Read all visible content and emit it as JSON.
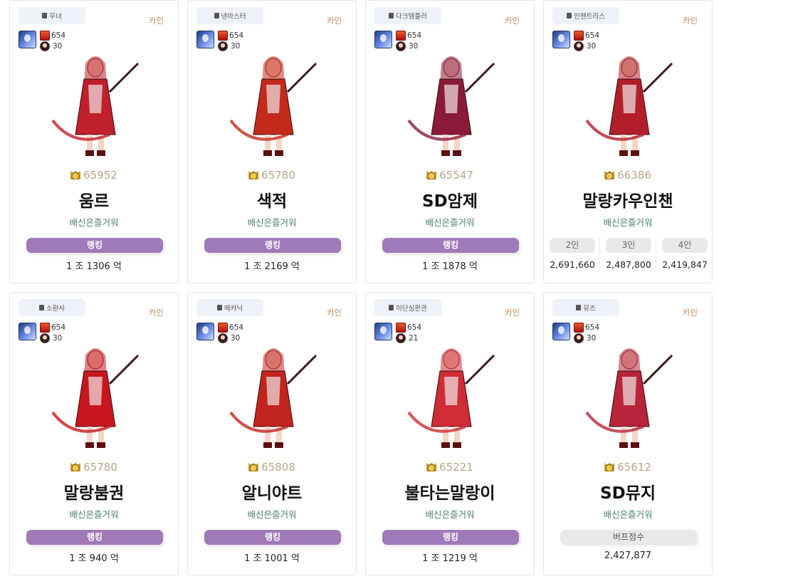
{
  "cards": [
    {
      "job": "무녀",
      "server": "카인",
      "fame": "654",
      "level": "30",
      "power": "65952",
      "name": "움르",
      "guild": "배신은즐거워",
      "rank_label": "랭킹",
      "rank_value": "1 조 1306 억",
      "kind": "rank",
      "art": "#c01f2c"
    },
    {
      "job": "넨마스터",
      "server": "카인",
      "fame": "654",
      "level": "30",
      "power": "65780",
      "name": "색적",
      "guild": "배신은즐거워",
      "rank_label": "랭킹",
      "rank_value": "1 조 2169 억",
      "kind": "rank",
      "art": "#c42a1c"
    },
    {
      "job": "다크템플러",
      "server": "카인",
      "fame": "654",
      "level": "30",
      "power": "65547",
      "name": "SD암제",
      "guild": "배신은즐거워",
      "rank_label": "랭킹",
      "rank_value": "1 조 1878 억",
      "kind": "rank",
      "art": "#8a1a3a"
    },
    {
      "job": "인챈트리스",
      "server": "카인",
      "fame": "654",
      "level": "30",
      "power": "66386",
      "name": "말랑카우인챈",
      "guild": "배신은즐거워",
      "kind": "party",
      "party": [
        {
          "label": "2인",
          "value": "2,691,660"
        },
        {
          "label": "3인",
          "value": "2,487,800"
        },
        {
          "label": "4인",
          "value": "2,419,847"
        }
      ],
      "art": "#b21f2b"
    },
    {
      "job": "소환사",
      "server": "카인",
      "fame": "654",
      "level": "30",
      "power": "65780",
      "name": "말랑붐권",
      "guild": "배신은즐거워",
      "rank_label": "랭킹",
      "rank_value": "1 조 940 억",
      "kind": "rank",
      "art": "#c8161e"
    },
    {
      "job": "메카닉",
      "server": "카인",
      "fame": "654",
      "level": "30",
      "power": "65808",
      "name": "알니야트",
      "guild": "배신은즐거워",
      "rank_label": "랭킹",
      "rank_value": "1 조 1001 억",
      "kind": "rank",
      "art": "#c4241e"
    },
    {
      "job": "이단심판관",
      "server": "카인",
      "fame": "654",
      "level": "21",
      "power": "65221",
      "name": "불타는말랑이",
      "guild": "배신은즐거워",
      "rank_label": "랭킹",
      "rank_value": "1 조 1219 억",
      "kind": "rank",
      "art": "#cf2c36"
    },
    {
      "job": "뮤즈",
      "server": "카인",
      "fame": "654",
      "level": "30",
      "power": "65612",
      "name": "SD뮤지",
      "guild": "배신은즐거워",
      "buff_label": "버프점수",
      "buff_value": "2,427,877",
      "kind": "buff",
      "art": "#b8243a"
    }
  ]
}
